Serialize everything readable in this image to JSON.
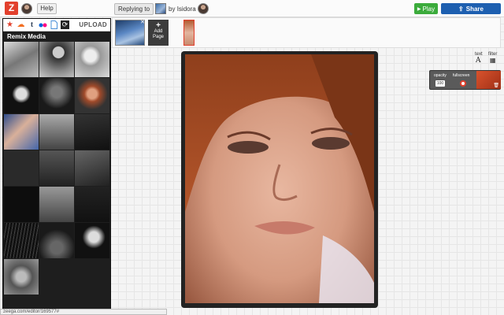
{
  "topbar": {
    "help_label": "Help",
    "replying_label": "Replying to",
    "by_label": "by Isidora",
    "play_label": "Play",
    "play_icon": "▶",
    "share_label": "Share",
    "share_icon": "⇪"
  },
  "sidebar": {
    "upload_label": "UPLOAD",
    "section_title": "Remix Media",
    "sources": [
      {
        "name": "zeega-star",
        "glyph": "★",
        "color": "#e2402d"
      },
      {
        "name": "soundcloud",
        "glyph": "☁",
        "color": "#f26f23"
      },
      {
        "name": "tumblr",
        "glyph": "t",
        "color": "#36465d"
      },
      {
        "name": "flickr",
        "glyph": "●",
        "color": "#ff0084"
      },
      {
        "name": "document",
        "glyph": "▭",
        "color": "#4a90d9"
      },
      {
        "name": "refresh",
        "glyph": "⟳",
        "color": "#222"
      }
    ]
  },
  "pages": {
    "add_page_label_1": "Add",
    "add_page_label_2": "Page"
  },
  "tools": {
    "text_label": "text",
    "text_glyph": "A",
    "filter_label": "filter",
    "filter_glyph": "▦"
  },
  "properties": {
    "opacity_label": "opacity",
    "opacity_value": "100",
    "fullscreen_label": "fullscreen"
  },
  "statusbar": {
    "url": "zeega.com/editor/169577#"
  }
}
